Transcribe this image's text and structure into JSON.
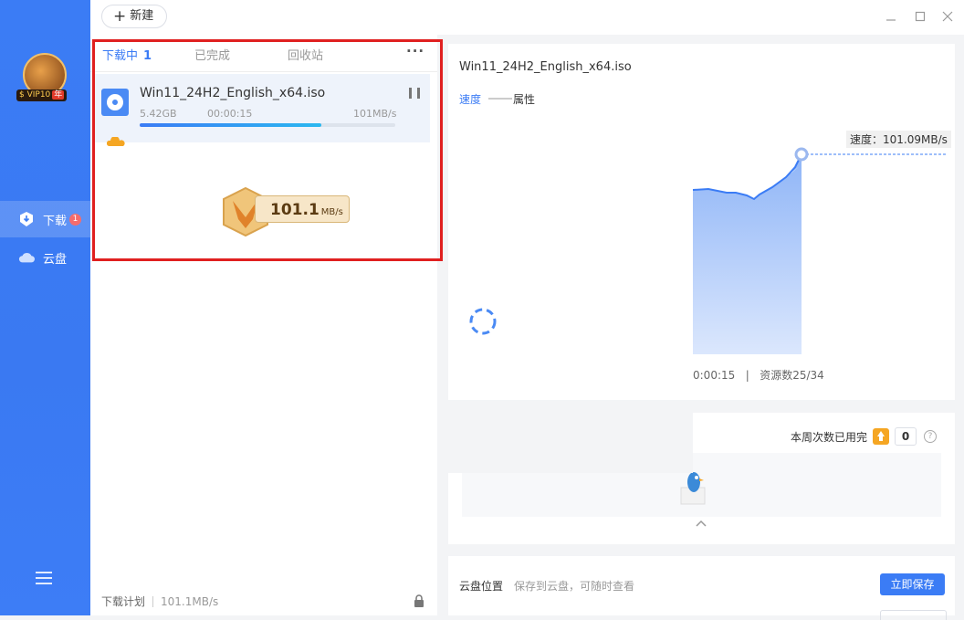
{
  "sidebar": {
    "vip_badge": "VIP10",
    "vip_year": "年",
    "items": [
      {
        "label": "下载",
        "badge": "1"
      },
      {
        "label": "云盘"
      }
    ]
  },
  "toolbar": {
    "new_label": "新建"
  },
  "tabs": [
    {
      "label": "下载中",
      "count": "1"
    },
    {
      "label": "已完成"
    },
    {
      "label": "回收站"
    }
  ],
  "more_label": "···",
  "task": {
    "name": "Win11_24H2_English_x64.iso",
    "size": "5.42GB",
    "elapsed": "00:00:15",
    "speed": "101MB/s",
    "progress": 0.71
  },
  "speed_badge": {
    "value": "101.1",
    "unit": "MB/s"
  },
  "footer": {
    "plan_label": "下载计划",
    "speed": "101.1MB/s"
  },
  "detail": {
    "title": "Win11_24H2_English_x64.iso",
    "tab_speed": "速度",
    "tab_attr": "属性",
    "speed_tip": "速度：101.09MB/s",
    "time_fragment": "0:00:15",
    "sources": "资源数25/34"
  },
  "quota": {
    "label": "本周次数已用完",
    "count": "0",
    "help": "?"
  },
  "cloud": {
    "label": "云盘位置",
    "desc": "保存到云盘，可随时查看",
    "save_btn": "立即保存"
  },
  "colors": {
    "accent": "#3b7cf5",
    "sidebar": "#3a79f2",
    "highlight_box": "#e02020"
  }
}
